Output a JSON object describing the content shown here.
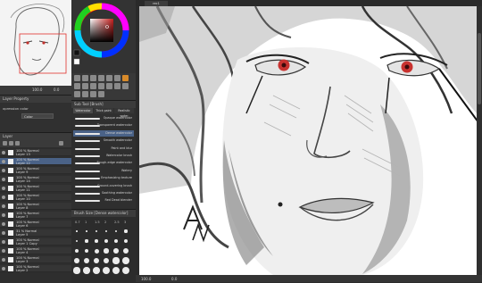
{
  "navigator": {
    "zoom": "100.0",
    "angle": "0.0"
  },
  "color": {
    "hue_ring": "color-wheel",
    "accent": "#c0302c"
  },
  "panels": {
    "layer_property_title": "Layer Property",
    "expression_color_label": "xpression color",
    "expression_color_value": "Color",
    "layer_title": "Layer",
    "subtool_title": "Sub Tool [Brush]",
    "brush_size_title": "Brush Size [Dense watercolor]"
  },
  "subtool_tabs": [
    "Watercolor",
    "Thick paint",
    "Realistic water"
  ],
  "brushes": [
    "Opaque watercolor",
    "Transparent watercolor",
    "Dense watercolor",
    "Smooth watercolor",
    "Paint and blur",
    "Watercolor brush",
    "Rough-edge watercolor",
    "Watery",
    "Emphasizing texture",
    "Ground-covering brush",
    "Soothing watercolor",
    "Red Dead blender"
  ],
  "brush_sizes": [
    "0.7",
    "1",
    "1.5",
    "2",
    "2.5",
    "3"
  ],
  "layers": [
    {
      "mode": "100 % Normal",
      "name": "Layer 13"
    },
    {
      "mode": "100 % Normal",
      "name": "Layer 12"
    },
    {
      "mode": "100 % Normal",
      "name": "Layer 9"
    },
    {
      "mode": "100 % Normal",
      "name": "Layer 14"
    },
    {
      "mode": "100 % Normal",
      "name": "Layer 11"
    },
    {
      "mode": "100 % Normal",
      "name": "Layer 10"
    },
    {
      "mode": "100 % Normal",
      "name": "Layer 8"
    },
    {
      "mode": "100 % Normal",
      "name": "Layer 7"
    },
    {
      "mode": "100 % Normal",
      "name": "Layer 6"
    },
    {
      "mode": "31 % Normal",
      "name": "Layer 5"
    },
    {
      "mode": "100 % Normal",
      "name": "Layer 1 Copy"
    },
    {
      "mode": "100 % Normal",
      "name": "Layer 4"
    },
    {
      "mode": "100 % Normal",
      "name": "Layer 3"
    },
    {
      "mode": "100 % Normal",
      "name": "Layer 2"
    }
  ],
  "canvas": {
    "tab_label": "rec1"
  },
  "status": {
    "zoom": "100.0",
    "angle": "0.0"
  }
}
